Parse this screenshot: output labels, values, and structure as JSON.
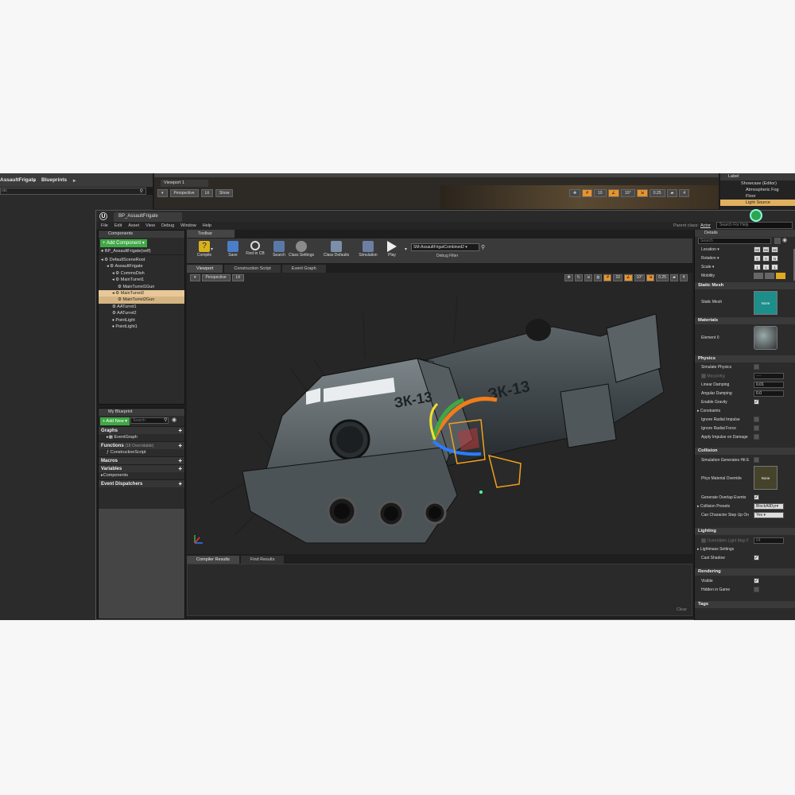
{
  "bg": {
    "breadcrumb_a": "AssaultFrigate",
    "breadcrumb_b": "Blueprints",
    "search_text": "nts",
    "viewport_tab": "Viewport 1",
    "perspective": "Perspective",
    "lit": "Lit",
    "show": "Show",
    "grid1": "10",
    "grid2": "10°",
    "grid3": "0.25",
    "grid4": "4",
    "outliner_header": "Label",
    "outliner": [
      "Showcase (Editor)",
      "Atmospheric Fog",
      "Floor",
      "Light Source"
    ]
  },
  "window": {
    "tab": "BP_AssaultFrigate",
    "menu": [
      "File",
      "Edit",
      "Asset",
      "View",
      "Debug",
      "Window",
      "Help"
    ],
    "parent_label": "Parent class:",
    "parent_value": "Actor",
    "help_placeholder": "Search For Help"
  },
  "components": {
    "tab": "Components",
    "add_label": "+ Add Component ▾",
    "self": "BP_AssaultFrigate(self)",
    "tree": [
      {
        "label": "DefaultSceneRoot",
        "indent": 0
      },
      {
        "label": "AssaultFrigate",
        "indent": 1
      },
      {
        "label": "CommsDish",
        "indent": 2
      },
      {
        "label": "MainTurret1",
        "indent": 2
      },
      {
        "label": "MainTurret1Gun",
        "indent": 3
      },
      {
        "label": "MainTurret2",
        "indent": 2,
        "selected": true
      },
      {
        "label": "MainTurret2Gun",
        "indent": 3,
        "selected": true
      },
      {
        "label": "AATurret1",
        "indent": 2
      },
      {
        "label": "AATurret2",
        "indent": 2
      },
      {
        "label": "PointLight",
        "indent": 2
      },
      {
        "label": "PointLight1",
        "indent": 2
      }
    ]
  },
  "myblueprint": {
    "tab": "My Blueprint",
    "add_new": "+ Add New ▾",
    "search_placeholder": "Search",
    "graphs": "Graphs",
    "event_graph": "EventGraph",
    "functions": "Functions",
    "functions_overridable": "(18 Overridable)",
    "construction_script": "ConstructionScript",
    "macros": "Macros",
    "variables": "Variables",
    "components": "Components",
    "event_dispatchers": "Event Dispatchers"
  },
  "toolbar": {
    "tab": "Toolbar",
    "compile": "Compile",
    "save": "Save",
    "find_in_cb": "Find in CB",
    "search": "Search",
    "class_settings": "Class Settings",
    "class_defaults": "Class Defaults",
    "simulation": "Simulation",
    "play": "Play",
    "debug_object": "SM-AssaultFrigatCombined2",
    "debug_filter": "Debug Filter"
  },
  "editor_tabs": [
    "Viewport",
    "Construction Script",
    "Event Graph"
  ],
  "viewport": {
    "perspective": "Perspective",
    "lit": "Lit",
    "snap1": "10",
    "snap2": "10°",
    "snap3": "0.25",
    "snap4": "4",
    "hull_text_a": "ЗК-13",
    "hull_text_b": "ЗК-13"
  },
  "bottom_tabs": [
    "Compiler Results",
    "Find Results"
  ],
  "bottom_clear": "Clear",
  "details": {
    "tab": "Details",
    "search_placeholder": "Search",
    "location": "Location ▾",
    "rotation": "Rotation ▾",
    "scale": "Scale ▾",
    "mobility": "Mobility",
    "static_mesh_section": "Static Mesh",
    "static_mesh_label": "Static Mesh",
    "none": "None",
    "materials_section": "Materials",
    "element0": "Element 0",
    "physics_section": "Physics",
    "simulate_physics": "Simulate Physics",
    "mass_kg": "MassInKg",
    "linear_damping": "Linear Damping",
    "linear_damping_val": "0.01",
    "angular_damping": "Angular Damping",
    "angular_damping_val": "0.0",
    "enable_gravity": "Enable Gravity",
    "constraints": "Constraints",
    "ignore_radial_impulse": "Ignore Radial Impulse",
    "ignore_radial_force": "Ignore Radial Force",
    "apply_impulse": "Apply Impulse on Damage",
    "collision_section": "Collision",
    "sim_generates_hit": "Simulation Generates Hit E",
    "phys_material": "Phys Material Override",
    "generate_overlap": "Generate Overlap Events",
    "collision_presets": "Collision Presets",
    "collision_presets_val": "BlockAllDyr",
    "can_step_up": "Can Character Step Up On",
    "can_step_up_val": "Yes",
    "lighting_section": "Lighting",
    "overridden_lightmap": "Overridden Light Map F",
    "overridden_lightmap_val": "64",
    "lightmass_settings": "Lightmass Settings",
    "cast_shadow": "Cast Shadow",
    "rendering_section": "Rendering",
    "visible": "Visible",
    "hidden_in_game": "Hidden in Game",
    "tags_section": "Tags"
  }
}
